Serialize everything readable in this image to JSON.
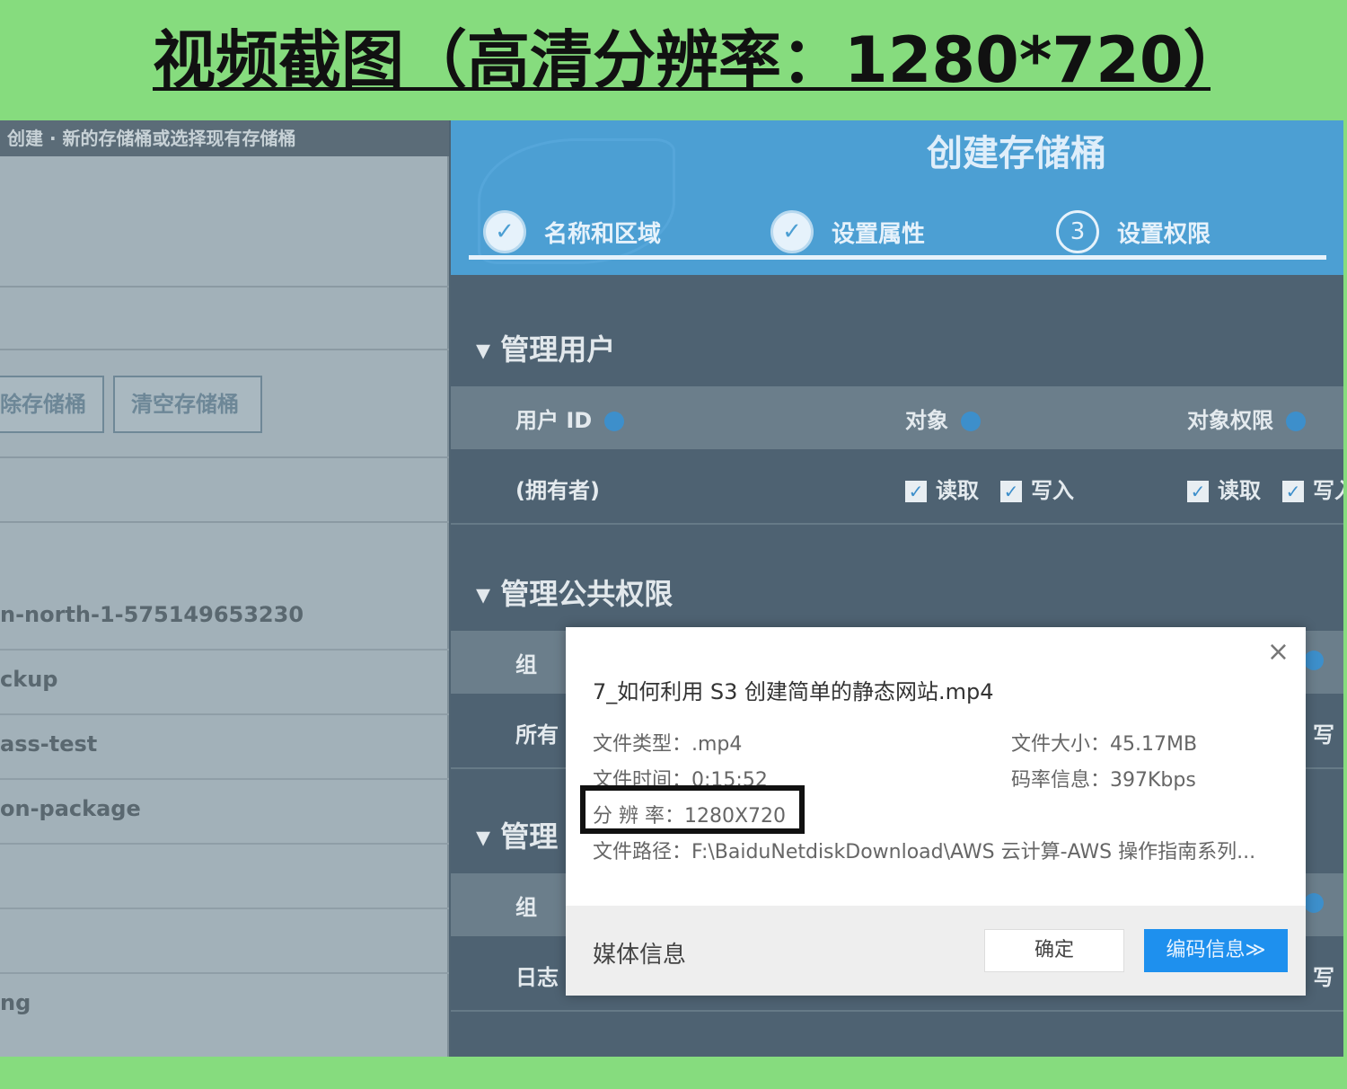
{
  "banner": {
    "title": "视频截图（高清分辨率：1280*720）"
  },
  "left_panel": {
    "topbar_text": "创建 · 新的存储桶或选择现有存储桶",
    "buttons": [
      "除存储桶",
      "清空存储桶"
    ],
    "rows": [
      "n-north-1-575149653230",
      "ckup",
      "ass-test",
      "on-package",
      "ng"
    ]
  },
  "right_panel": {
    "title": "创建存储桶",
    "steps": [
      {
        "number": "",
        "label": "名称和区域",
        "done": true
      },
      {
        "number": "",
        "label": "设置属性",
        "done": true
      },
      {
        "number": "3",
        "label": "设置权限",
        "done": false
      }
    ],
    "section_users": "管理用户",
    "users_table": {
      "headers": [
        "用户 ID",
        "对象",
        "对象权限"
      ],
      "row_label": "(拥有者)",
      "read": "读取",
      "write": "写入",
      "write_cut": "写入"
    },
    "section_public": "管理公共权限",
    "public_rows": [
      "组",
      "所有"
    ],
    "section_logs": "管理",
    "log_rows": [
      "组",
      "日志"
    ],
    "write_cut": "写"
  },
  "dialog": {
    "filename": "7_如何利用 S3 创建简单的静态网站.mp4",
    "file_type": "文件类型：.mp4",
    "file_size": "文件大小：45.17MB",
    "file_time": "文件时间：0:15:52",
    "bitrate": "码率信息：397Kbps",
    "resolution": "分 辨 率：1280X720",
    "file_path": "文件路径：F:\\BaiduNetdiskDownload\\AWS 云计算-AWS 操作指南系列...",
    "footer_label": "媒体信息",
    "ok_label": "确定",
    "codec_label": "编码信息≫",
    "close_glyph": "×"
  },
  "colors": {
    "background_green": "#86dc7e",
    "header_blue": "#4c9fd3",
    "primary_button": "#1e90ee"
  }
}
